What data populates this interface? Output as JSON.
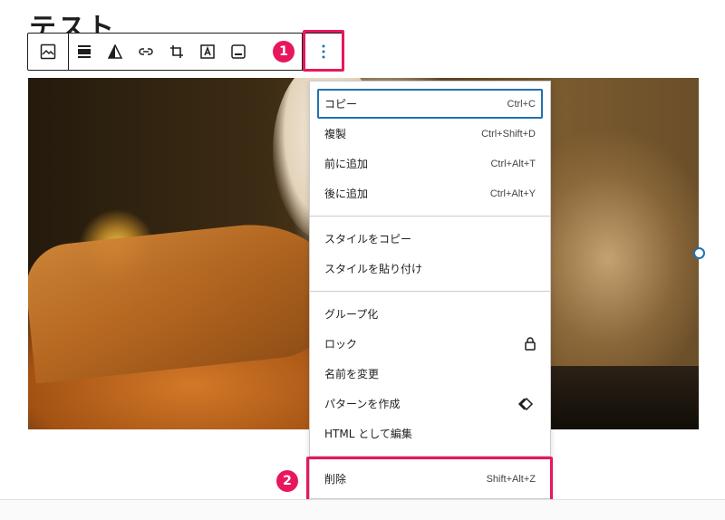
{
  "page": {
    "title_fragment": "テスト"
  },
  "toolbar": {
    "groups": {
      "type": [
        "image-block-icon"
      ],
      "tools": [
        "align-icon",
        "duotone-icon",
        "link-icon",
        "crop-icon",
        "text-over-image-icon",
        "caption-icon"
      ],
      "more": [
        "more-options-icon"
      ]
    }
  },
  "annotations": {
    "step1": "1",
    "step2": "2"
  },
  "menu": {
    "sections": [
      [
        {
          "label": "コピー",
          "shortcut": "Ctrl+C"
        },
        {
          "label": "複製",
          "shortcut": "Ctrl+Shift+D"
        },
        {
          "label": "前に追加",
          "shortcut": "Ctrl+Alt+T"
        },
        {
          "label": "後に追加",
          "shortcut": "Ctrl+Alt+Y"
        }
      ],
      [
        {
          "label": "スタイルをコピー"
        },
        {
          "label": "スタイルを貼り付け"
        }
      ],
      [
        {
          "label": "グループ化"
        },
        {
          "label": "ロック",
          "icon": "lock-icon"
        },
        {
          "label": "名前を変更"
        },
        {
          "label": "パターンを作成",
          "icon": "pattern-icon"
        },
        {
          "label": "HTML として編集"
        }
      ],
      [
        {
          "label": "削除",
          "shortcut": "Shift+Alt+Z"
        }
      ]
    ]
  },
  "colors": {
    "accent": "#e8175d",
    "focus": "#2271b1"
  }
}
